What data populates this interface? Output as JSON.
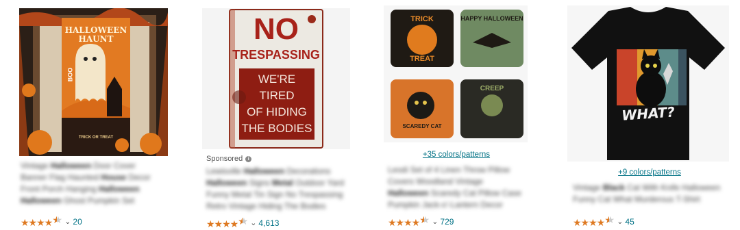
{
  "products": [
    {
      "image_text": {
        "title": "HALLOWEEN HAUNT",
        "boo": "BOO",
        "bottom": "TRICK OR TREAT"
      },
      "rating_count": "20",
      "stars": 4.5
    },
    {
      "sponsored": "Sponsored",
      "image_text": {
        "no": "NO",
        "trespassing": "TRESPASSING",
        "line1": "WE'RE",
        "line2": "TIRED",
        "line3": "OF HIDING",
        "line4": "THE BODIES"
      },
      "rating_count": "4,613",
      "stars": 4.5
    },
    {
      "image_text": {
        "p1a": "TRICK",
        "p1b": "TREAT",
        "p2": "HAPPY HALLOWEEN",
        "p3": "SCAREDY CAT",
        "p4": "CREEP"
      },
      "colors_link": "+35 colors/patterns",
      "rating_count": "729",
      "stars": 4.5
    },
    {
      "image_text": {
        "caption": "WHAT?"
      },
      "colors_link": "+9 colors/patterns",
      "rating_count": "45",
      "stars": 4.5
    }
  ],
  "colors": {
    "star": "#de7921",
    "link": "#007185"
  }
}
